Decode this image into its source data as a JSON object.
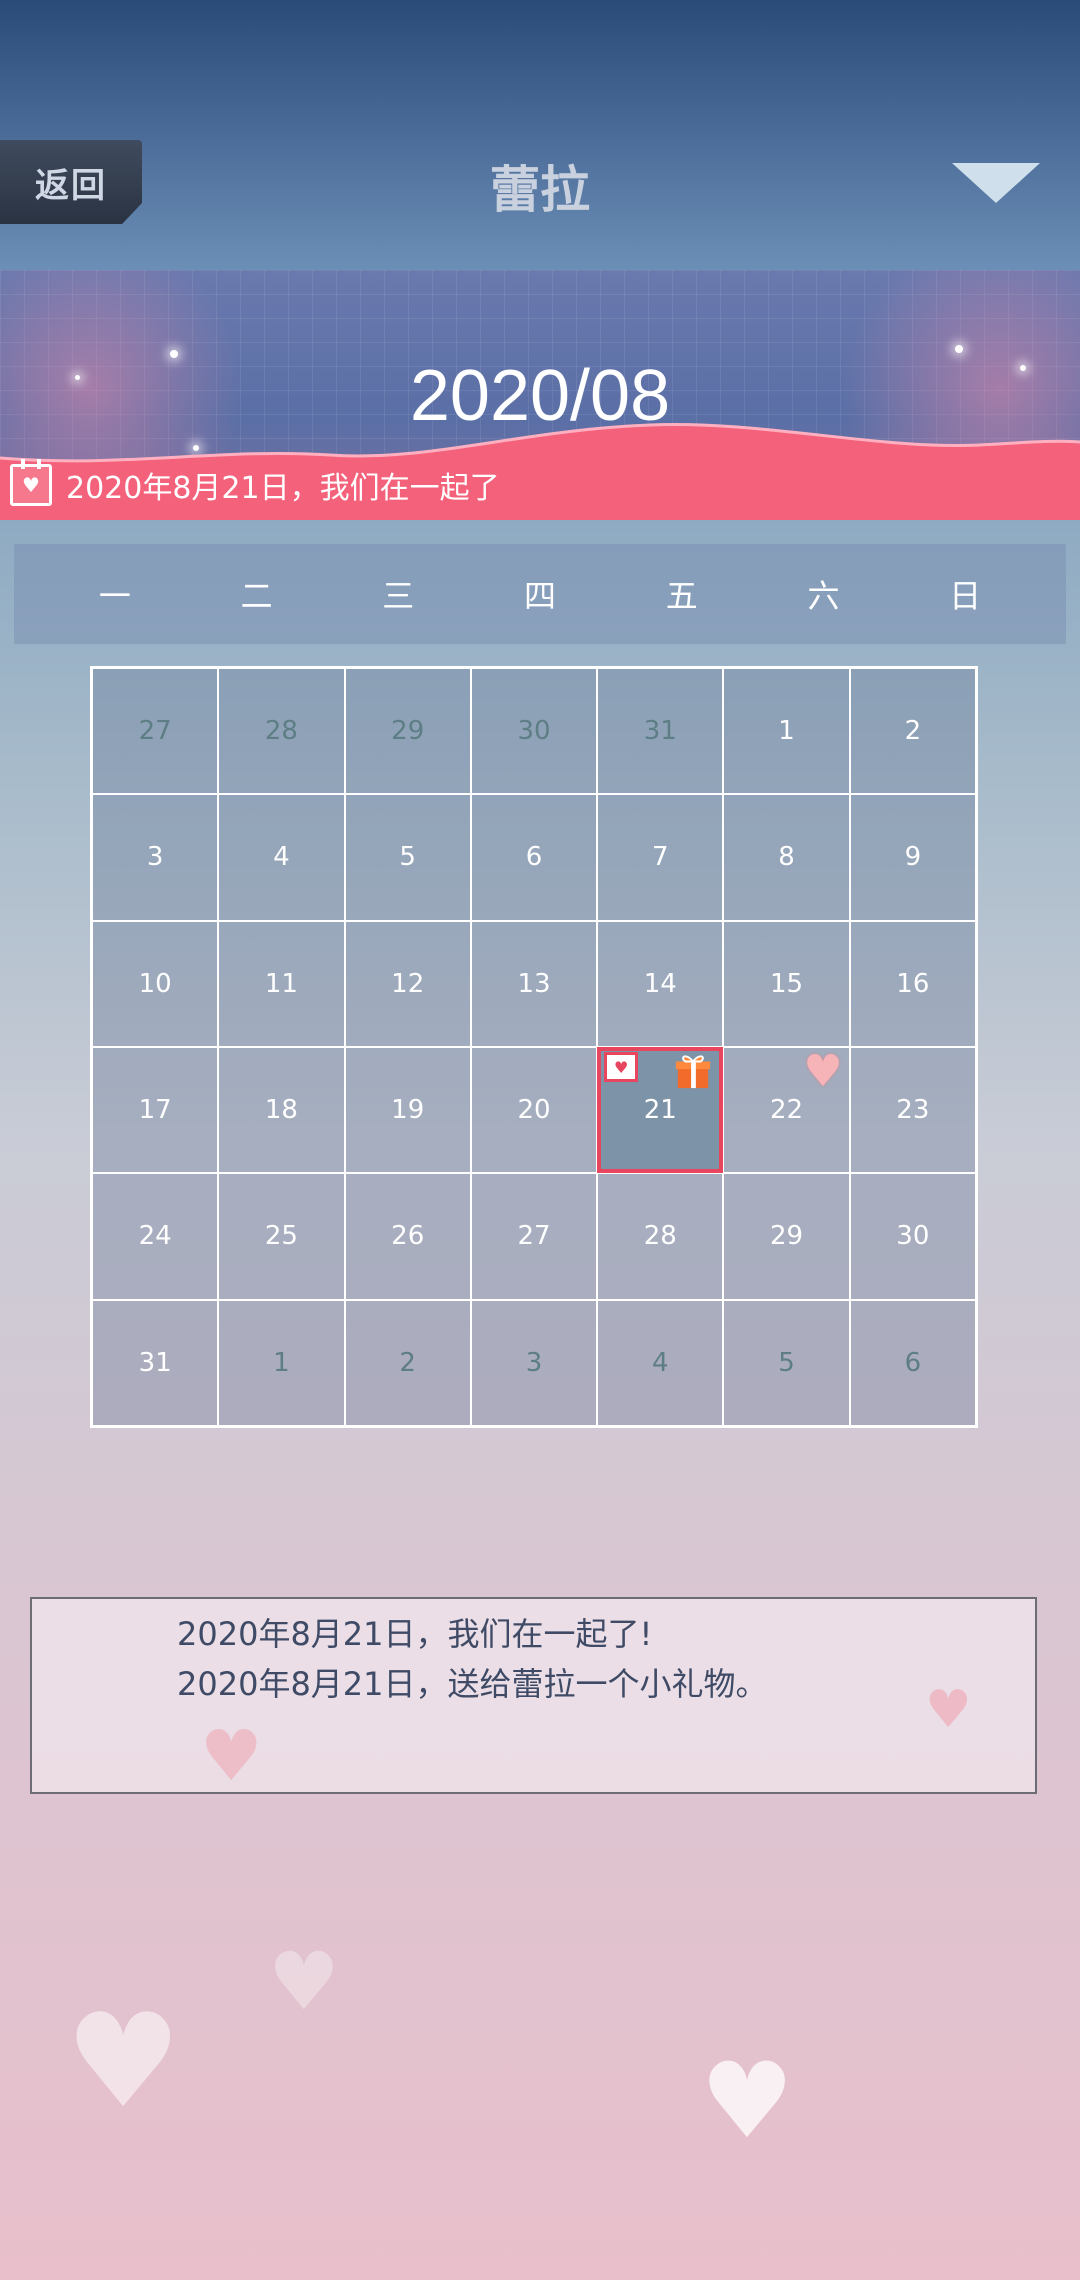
{
  "header": {
    "back_label": "返回",
    "title": "蕾拉"
  },
  "banner": {
    "month": "2020/08",
    "anniversary": "2020年8月21日，我们在一起了"
  },
  "weekdays": [
    "一",
    "二",
    "三",
    "四",
    "五",
    "六",
    "日"
  ],
  "calendar": {
    "selected_day": "21",
    "days": [
      {
        "day": "27",
        "other_month": true
      },
      {
        "day": "28",
        "other_month": true
      },
      {
        "day": "29",
        "other_month": true
      },
      {
        "day": "30",
        "other_month": true
      },
      {
        "day": "31",
        "other_month": true
      },
      {
        "day": "1"
      },
      {
        "day": "2"
      },
      {
        "day": "3"
      },
      {
        "day": "4"
      },
      {
        "day": "5"
      },
      {
        "day": "6"
      },
      {
        "day": "7"
      },
      {
        "day": "8"
      },
      {
        "day": "9"
      },
      {
        "day": "10"
      },
      {
        "day": "11"
      },
      {
        "day": "12"
      },
      {
        "day": "13"
      },
      {
        "day": "14"
      },
      {
        "day": "15"
      },
      {
        "day": "16"
      },
      {
        "day": "17"
      },
      {
        "day": "18"
      },
      {
        "day": "19"
      },
      {
        "day": "20"
      },
      {
        "day": "21",
        "selected": true,
        "marks": [
          "calendar-heart-icon",
          "gift-icon"
        ]
      },
      {
        "day": "22",
        "marks": [
          "heart-icon"
        ]
      },
      {
        "day": "23"
      },
      {
        "day": "24"
      },
      {
        "day": "25"
      },
      {
        "day": "26"
      },
      {
        "day": "27"
      },
      {
        "day": "28"
      },
      {
        "day": "29"
      },
      {
        "day": "30"
      },
      {
        "day": "31"
      },
      {
        "day": "1",
        "other_month": true
      },
      {
        "day": "2",
        "other_month": true
      },
      {
        "day": "3",
        "other_month": true
      },
      {
        "day": "4",
        "other_month": true
      },
      {
        "day": "5",
        "other_month": true
      },
      {
        "day": "6",
        "other_month": true
      }
    ]
  },
  "notes": [
    "2020年8月21日，我们在一起了!",
    "2020年8月21日，送给蕾拉一个小礼物。"
  ],
  "colors": {
    "accent": "#e8455f",
    "other_month_text": "#5e7e86"
  }
}
